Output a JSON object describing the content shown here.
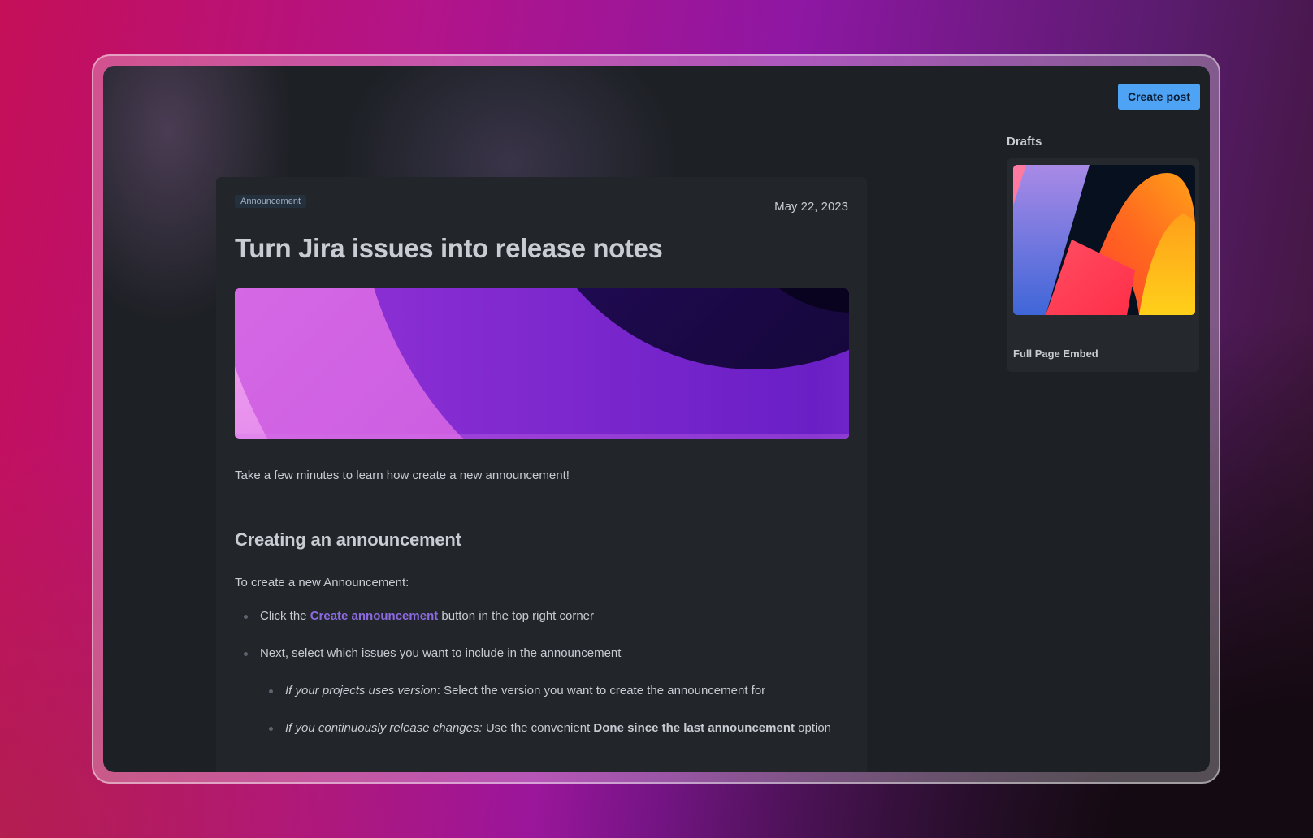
{
  "toolbar": {
    "create_post_label": "Create post"
  },
  "post": {
    "tag": "Announcement",
    "date": "May 22, 2023",
    "title": "Turn Jira issues into release notes",
    "intro": "Take a few minutes to learn how create a new announcement!",
    "section_heading": "Creating an announcement",
    "lead": "To create a new Announcement:",
    "step1": {
      "before": "Click the ",
      "link": "Create announcement",
      "after": " button in the top right corner"
    },
    "step2": "Next, select which issues you want to include in the announcement",
    "sub1": {
      "em": "If your projects uses version",
      "rest": ": Select the version you want to create the announcement for"
    },
    "sub2": {
      "em": "If you continuously release changes:",
      "mid": " Use the convenient ",
      "strong": "Done since the last announcement",
      "after": " option"
    }
  },
  "sidebar": {
    "title": "Drafts",
    "drafts": [
      {
        "label": "Full Page Embed"
      }
    ]
  },
  "colors": {
    "accent_button": "#4ea3f5",
    "link": "#8c6ae0",
    "card_bg": "#22262b",
    "app_bg": "#1d2025"
  }
}
